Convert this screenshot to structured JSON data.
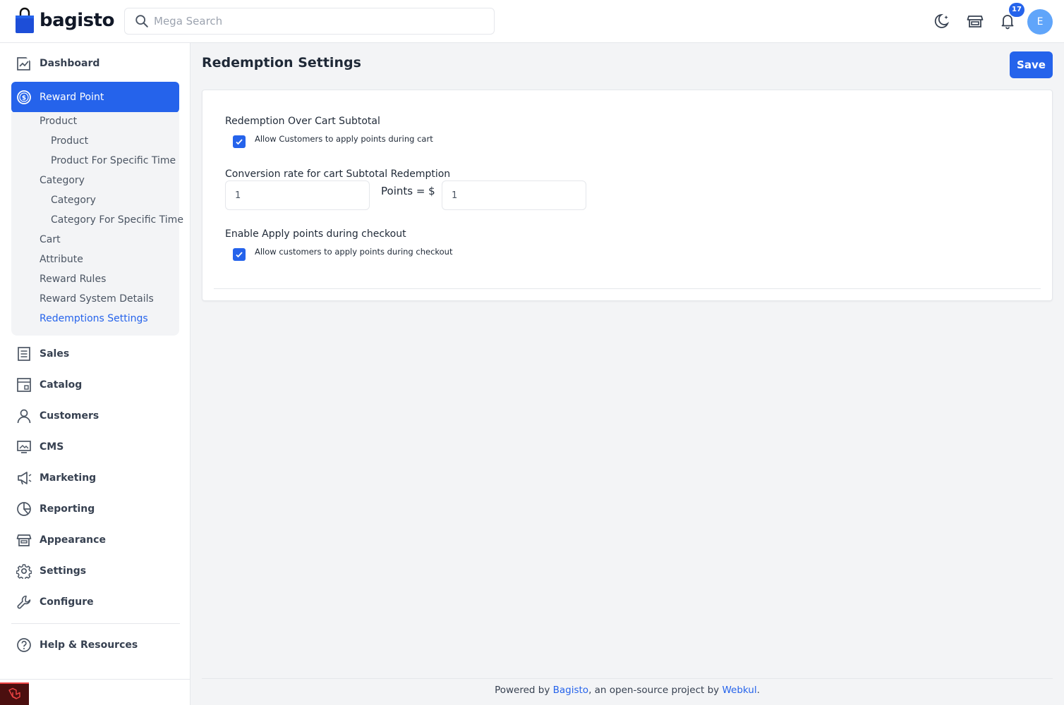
{
  "header": {
    "brand": "bagisto",
    "search_placeholder": "Mega Search",
    "notification_count": "17",
    "avatar_initial": "E"
  },
  "sidebar": {
    "dashboard": "Dashboard",
    "reward_point": "Reward Point",
    "submenu": {
      "product_group": "Product",
      "product": "Product",
      "product_specific_time": "Product For Specific Time",
      "category_group": "Category",
      "category": "Category",
      "category_specific_time": "Category For Specific Time",
      "cart": "Cart",
      "attribute": "Attribute",
      "reward_rules": "Reward Rules",
      "reward_system_details": "Reward System Details",
      "redemptions_settings": "Redemptions Settings"
    },
    "sales": "Sales",
    "catalog": "Catalog",
    "customers": "Customers",
    "cms": "CMS",
    "marketing": "Marketing",
    "reporting": "Reporting",
    "appearance": "Appearance",
    "settings": "Settings",
    "configure": "Configure",
    "help": "Help & Resources"
  },
  "main": {
    "title": "Redemption Settings",
    "save_label": "Save",
    "subtotal_label": "Redemption Over Cart Subtotal",
    "subtotal_checkbox_label": "Allow Customers to apply points during cart",
    "conversion_label": "Conversion rate for cart Subtotal Redemption",
    "points_value": "1",
    "points_equals_label": "Points = $",
    "dollar_value": "1",
    "checkout_label": "Enable Apply points during checkout",
    "checkout_checkbox_label": "Allow customers to apply points during checkout"
  },
  "footer": {
    "prefix": "Powered by ",
    "bagisto_link": "Bagisto",
    "middle": ", an open-source project by ",
    "webkul_link": "Webkul",
    "suffix": "."
  },
  "colors": {
    "accent": "#2563eb",
    "avatar": "#60a5fa"
  }
}
